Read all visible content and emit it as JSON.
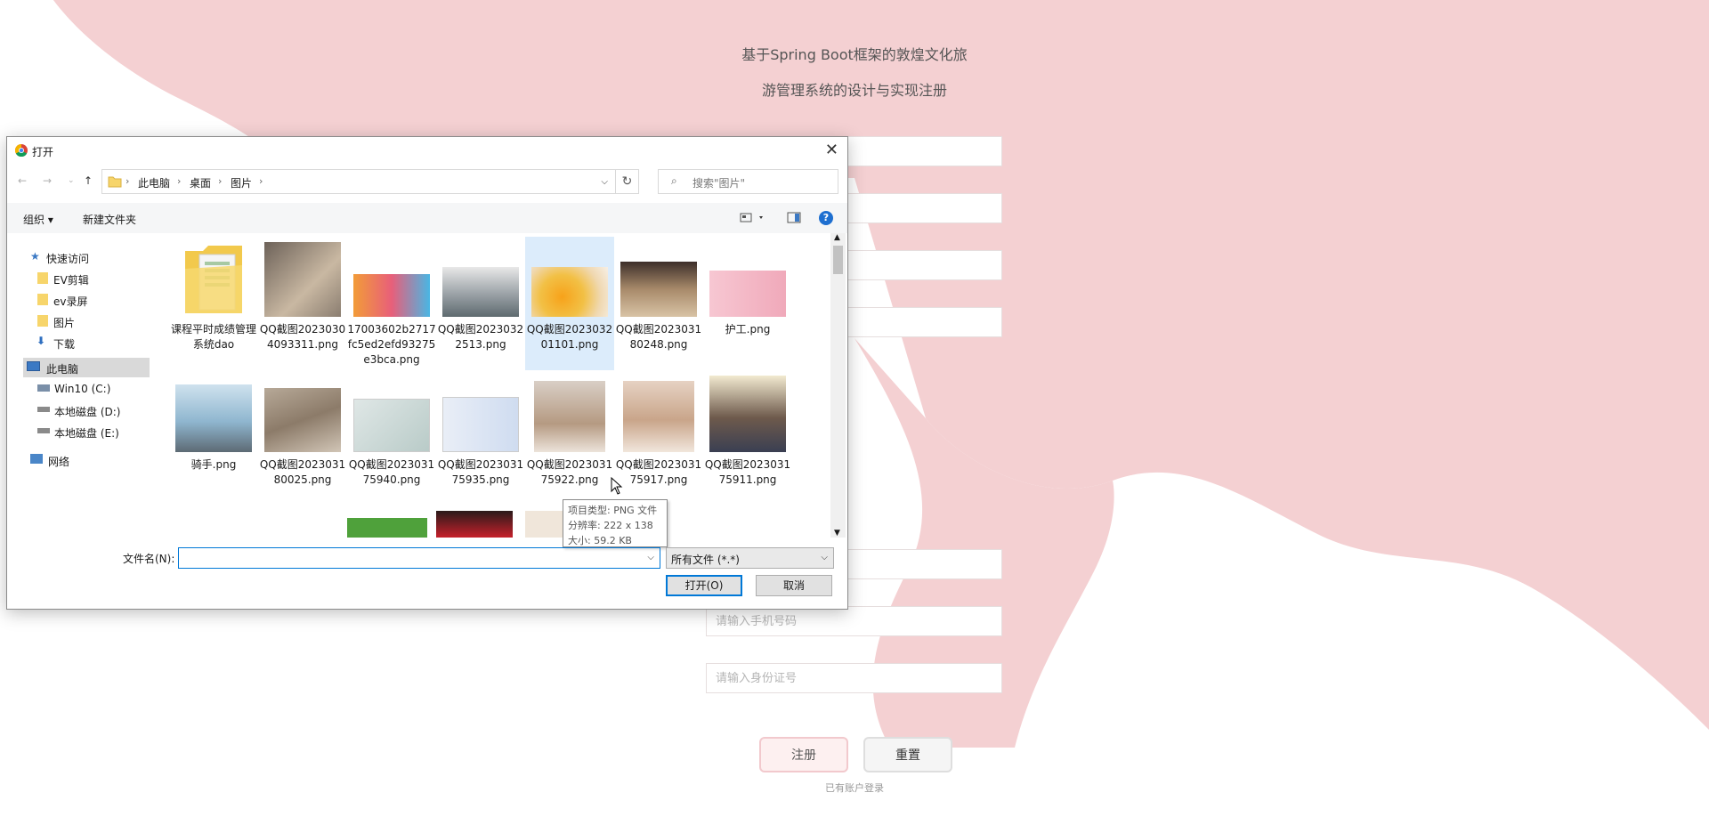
{
  "page": {
    "title_line1": "基于Spring Boot框架的敦煌文化旅",
    "title_line2": "游管理系统的设计与实现注册",
    "phone_placeholder": "请输入手机号码",
    "idcard_placeholder": "请输入身份证号",
    "submit_label": "注册",
    "reset_label": "重置",
    "login_link": "已有账户登录",
    "colors": {
      "accent_pink": "#f4d0d2"
    }
  },
  "dialog": {
    "title": "打开",
    "breadcrumb": [
      "此电脑",
      "桌面",
      "图片"
    ],
    "search_placeholder": "搜索\"图片\"",
    "toolbar": {
      "organize": "组织 ▾",
      "new_folder": "新建文件夹"
    },
    "nav": {
      "quick_access": "快速访问",
      "folders": [
        "EV剪辑",
        "ev录屏",
        "图片",
        "下载"
      ],
      "this_pc": "此电脑",
      "drives": [
        "Win10 (C:)",
        "本地磁盘 (D:)",
        "本地磁盘 (E:)"
      ],
      "network": "网络"
    },
    "files": [
      {
        "name": "课程平时成绩管理系统dao"
      },
      {
        "name": "QQ截图20230304093311.png"
      },
      {
        "name": "17003602b2717fc5ed2efd93275e3bca.png"
      },
      {
        "name": "QQ截图20230322513.png"
      },
      {
        "name": "QQ截图202303201101.png"
      },
      {
        "name": "QQ截图202303180248.png"
      },
      {
        "name": "护工.png"
      },
      {
        "name": "骑手.png"
      },
      {
        "name": "QQ截图202303180025.png"
      },
      {
        "name": "QQ截图202303175940.png"
      },
      {
        "name": "QQ截图202303175935.png"
      },
      {
        "name": "QQ截图202303175922.png"
      },
      {
        "name": "QQ截图202303175917.png"
      },
      {
        "name": "QQ截图202303175911.png"
      }
    ],
    "tooltip": {
      "type": "项目类型: PNG 文件",
      "resolution": "分辨率: 222 x 138",
      "size": "大小: 59.2 KB"
    },
    "filename_label": "文件名(N):",
    "filename_value": "",
    "filetype": "所有文件 (*.*)",
    "open_label": "打开(O)",
    "cancel_label": "取消"
  }
}
